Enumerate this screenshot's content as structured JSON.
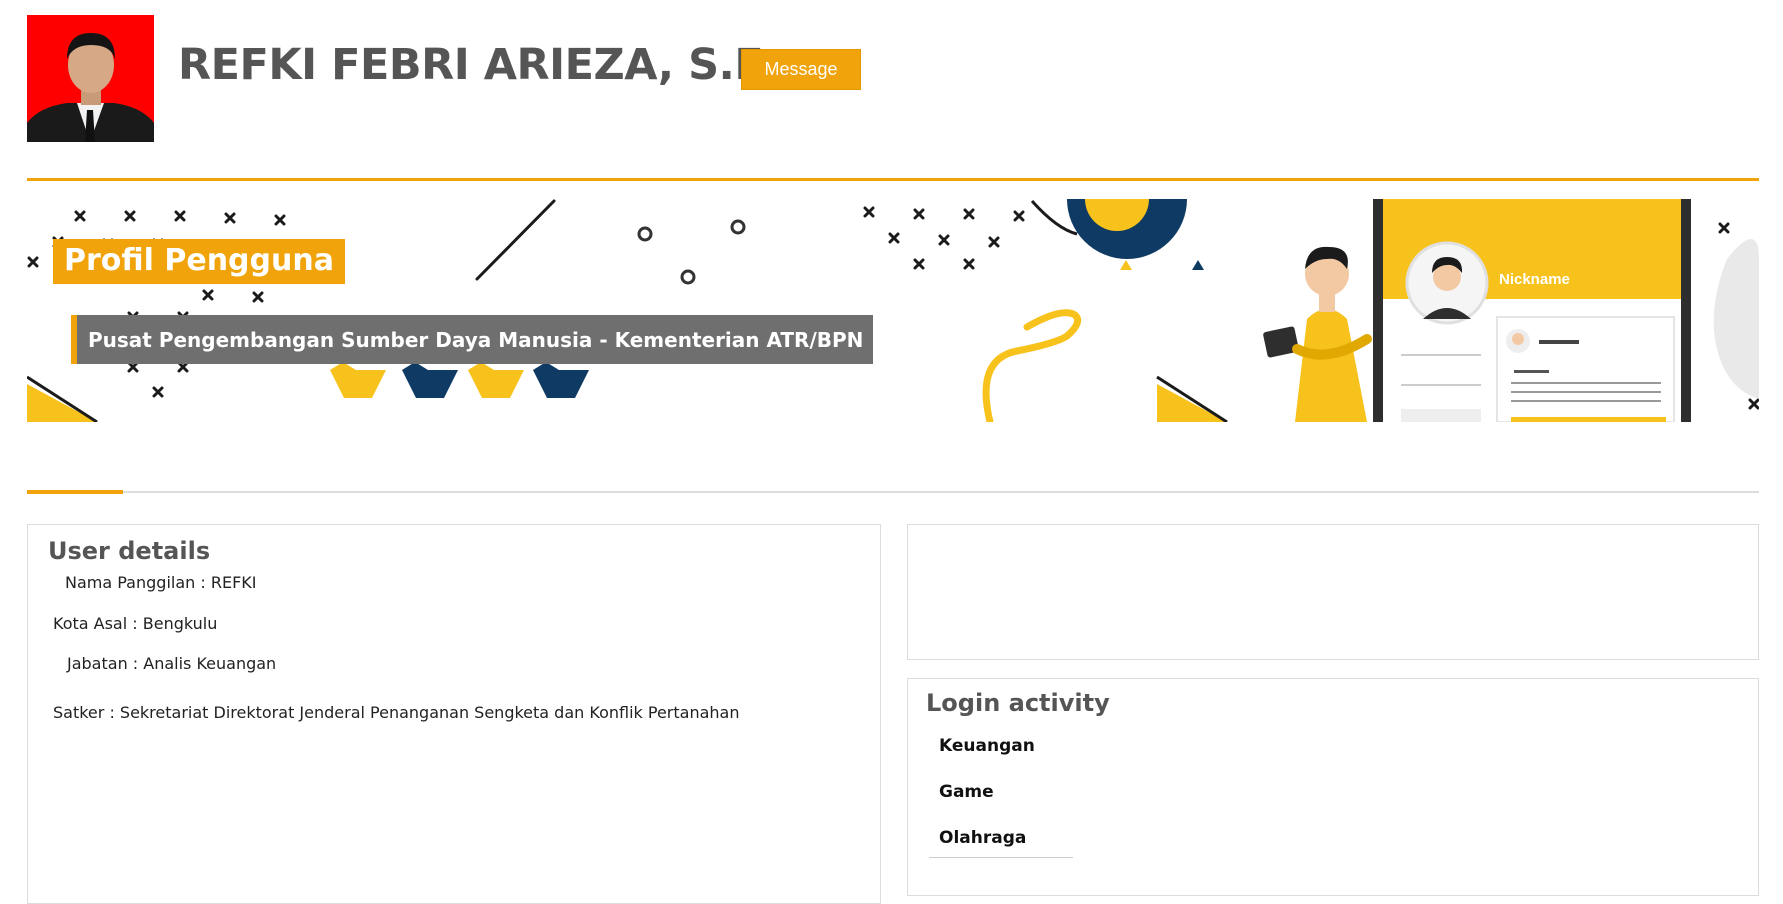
{
  "header": {
    "user_name": "REFKI FEBRI ARIEZA, S.E. .",
    "message_label": "Message"
  },
  "banner": {
    "title": "Profil Pengguna",
    "subtitle": "Pusat Pengembangan Sumber Daya Manusia - Kementerian ATR/BPN",
    "illustration_label": "Nickname"
  },
  "user_details": {
    "title": "User details",
    "nickname": "Nama Panggilan : REFKI",
    "hometown": "Kota Asal : Bengkulu",
    "position": "Jabatan : Analis Keuangan",
    "work_unit": "Satker : Sekretariat Direktorat Jenderal Penanganan Sengketa dan Konflik Pertanahan"
  },
  "login_activity": {
    "title": "Login activity",
    "items": [
      "Keuangan",
      "Game",
      "Olahraga"
    ]
  },
  "colors": {
    "accent": "#f0a30a",
    "navy": "#0f3a63",
    "yellow": "#f7c21c",
    "subtitle_bg": "#6f6f6f"
  },
  "icons": [
    "avatar-photo",
    "banner-illustration"
  ]
}
